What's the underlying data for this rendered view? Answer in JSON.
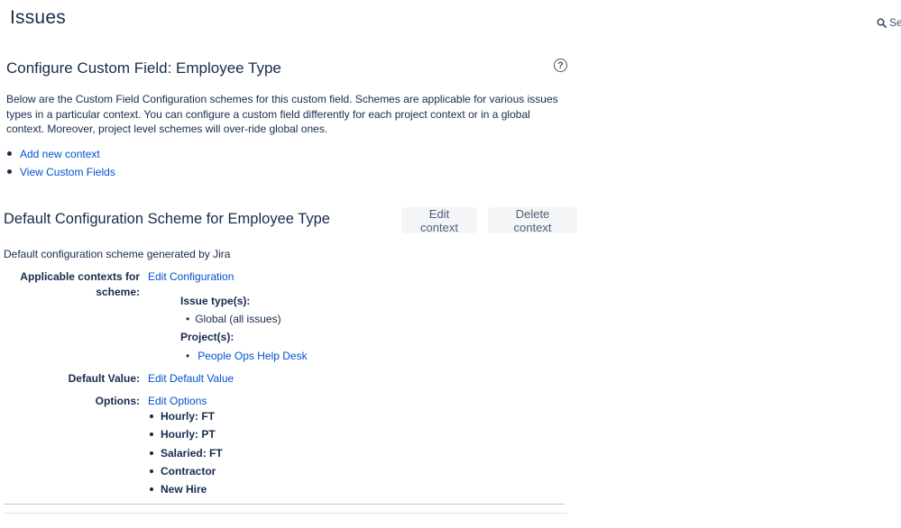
{
  "header": {
    "title": "Issues",
    "search_text": "Se"
  },
  "custom_field": {
    "title": "Configure Custom Field: Employee Type",
    "description": "Below are the Custom Field Configuration schemes for this custom field. Schemes are applicable for various issues types in a particular context. You can configure a custom field differently for each project context or in a global context. Moreover, project level schemes will over-ride global ones.",
    "links": [
      {
        "label": "Add new context"
      },
      {
        "label": "View Custom Fields"
      }
    ],
    "help_icon": "question-circle-icon"
  },
  "scheme": {
    "title": "Default Configuration Scheme for Employee Type",
    "edit_button": "Edit context",
    "delete_button": "Delete context",
    "description": "Default configuration scheme generated by Jira",
    "contexts_label": "Applicable contexts for scheme:",
    "edit_configuration": "Edit Configuration",
    "issue_types_heading": "Issue type(s):",
    "issue_types": [
      "Global (all issues)"
    ],
    "projects_heading": "Project(s):",
    "projects": [
      "People Ops Help Desk"
    ],
    "default_value_label": "Default Value:",
    "edit_default_value": "Edit Default Value",
    "options_label": "Options:",
    "edit_options": "Edit Options",
    "options": [
      "Hourly: FT",
      "Hourly: PT",
      "Salaried: FT",
      "Contractor",
      "New Hire"
    ]
  },
  "colors": {
    "text": "#172b4d",
    "link": "#0052cc",
    "button_bg": "#f4f5f7",
    "button_text": "#505f79"
  }
}
